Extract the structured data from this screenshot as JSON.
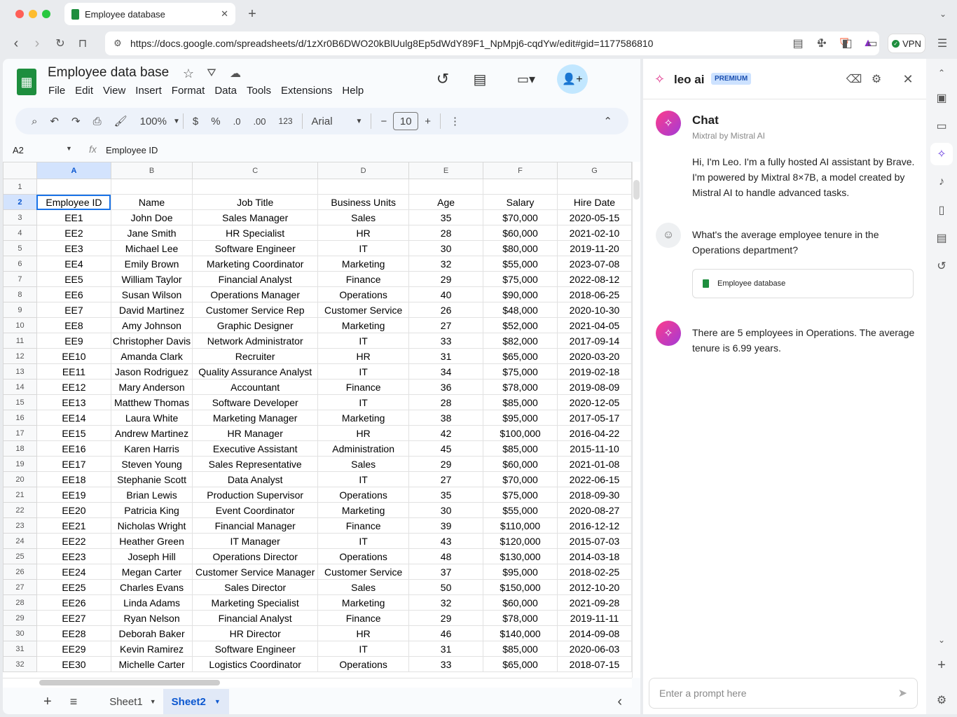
{
  "browser": {
    "tab_title": "Employee database",
    "url": "https://docs.google.com/spreadsheets/d/1zXr0B6DWO20kBlUulg8Ep5dWdY89F1_NpMpj6-cqdYw/edit#gid=1177586810",
    "vpn_label": "VPN",
    "brave_badge": "3"
  },
  "doc": {
    "title": "Employee data base",
    "menu": [
      "File",
      "Edit",
      "View",
      "Insert",
      "Format",
      "Data",
      "Tools",
      "Extensions",
      "Help"
    ]
  },
  "toolbar": {
    "zoom": "100%",
    "currency": "$",
    "percent": "%",
    "dec_less": ".0",
    "dec_more": ".00",
    "number_format": "123",
    "font": "Arial",
    "font_size": "10"
  },
  "formula_bar": {
    "cell_ref": "A2",
    "fx": "fx",
    "value": "Employee ID"
  },
  "sheet": {
    "columns": [
      "A",
      "B",
      "C",
      "D",
      "E",
      "F",
      "G"
    ],
    "header": [
      "Employee ID",
      "Name",
      "Job Title",
      "Business Units",
      "Age",
      "Salary",
      "Hire Date"
    ],
    "rows": [
      [
        "EE1",
        "John Doe",
        "Sales Manager",
        "Sales",
        "35",
        "$70,000",
        "2020-05-15"
      ],
      [
        "EE2",
        "Jane Smith",
        "HR Specialist",
        "HR",
        "28",
        "$60,000",
        "2021-02-10"
      ],
      [
        "EE3",
        "Michael Lee",
        "Software Engineer",
        "IT",
        "30",
        "$80,000",
        "2019-11-20"
      ],
      [
        "EE4",
        "Emily Brown",
        "Marketing Coordinator",
        "Marketing",
        "32",
        "$55,000",
        "2023-07-08"
      ],
      [
        "EE5",
        "William Taylor",
        "Financial Analyst",
        "Finance",
        "29",
        "$75,000",
        "2022-08-12"
      ],
      [
        "EE6",
        "Susan Wilson",
        "Operations Manager",
        "Operations",
        "40",
        "$90,000",
        "2018-06-25"
      ],
      [
        "EE7",
        "David Martinez",
        "Customer Service Rep",
        "Customer Service",
        "26",
        "$48,000",
        "2020-10-30"
      ],
      [
        "EE8",
        "Amy Johnson",
        "Graphic Designer",
        "Marketing",
        "27",
        "$52,000",
        "2021-04-05"
      ],
      [
        "EE9",
        "Christopher Davis",
        "Network Administrator",
        "IT",
        "33",
        "$82,000",
        "2017-09-14"
      ],
      [
        "EE10",
        "Amanda Clark",
        "Recruiter",
        "HR",
        "31",
        "$65,000",
        "2020-03-20"
      ],
      [
        "EE11",
        "Jason Rodriguez",
        "Quality Assurance Analyst",
        "IT",
        "34",
        "$75,000",
        "2019-02-18"
      ],
      [
        "EE12",
        "Mary Anderson",
        "Accountant",
        "Finance",
        "36",
        "$78,000",
        "2019-08-09"
      ],
      [
        "EE13",
        "Matthew Thomas",
        "Software Developer",
        "IT",
        "28",
        "$85,000",
        "2020-12-05"
      ],
      [
        "EE14",
        "Laura White",
        "Marketing Manager",
        "Marketing",
        "38",
        "$95,000",
        "2017-05-17"
      ],
      [
        "EE15",
        "Andrew Martinez",
        "HR Manager",
        "HR",
        "42",
        "$100,000",
        "2016-04-22"
      ],
      [
        "EE16",
        "Karen Harris",
        "Executive Assistant",
        "Administration",
        "45",
        "$85,000",
        "2015-11-10"
      ],
      [
        "EE17",
        "Steven Young",
        "Sales Representative",
        "Sales",
        "29",
        "$60,000",
        "2021-01-08"
      ],
      [
        "EE18",
        "Stephanie Scott",
        "Data Analyst",
        "IT",
        "27",
        "$70,000",
        "2022-06-15"
      ],
      [
        "EE19",
        "Brian Lewis",
        "Production Supervisor",
        "Operations",
        "35",
        "$75,000",
        "2018-09-30"
      ],
      [
        "EE20",
        "Patricia King",
        "Event Coordinator",
        "Marketing",
        "30",
        "$55,000",
        "2020-08-27"
      ],
      [
        "EE21",
        "Nicholas Wright",
        "Financial Manager",
        "Finance",
        "39",
        "$110,000",
        "2016-12-12"
      ],
      [
        "EE22",
        "Heather Green",
        "IT Manager",
        "IT",
        "43",
        "$120,000",
        "2015-07-03"
      ],
      [
        "EE23",
        "Joseph Hill",
        "Operations Director",
        "Operations",
        "48",
        "$130,000",
        "2014-03-18"
      ],
      [
        "EE24",
        "Megan Carter",
        "Customer Service Manager",
        "Customer Service",
        "37",
        "$95,000",
        "2018-02-25"
      ],
      [
        "EE25",
        "Charles Evans",
        "Sales Director",
        "Sales",
        "50",
        "$150,000",
        "2012-10-20"
      ],
      [
        "EE26",
        "Linda Adams",
        "Marketing Specialist",
        "Marketing",
        "32",
        "$60,000",
        "2021-09-28"
      ],
      [
        "EE27",
        "Ryan Nelson",
        "Financial Analyst",
        "Finance",
        "29",
        "$78,000",
        "2019-11-11"
      ],
      [
        "EE28",
        "Deborah Baker",
        "HR Director",
        "HR",
        "46",
        "$140,000",
        "2014-09-08"
      ],
      [
        "EE29",
        "Kevin Ramirez",
        "Software Engineer",
        "IT",
        "31",
        "$85,000",
        "2020-06-03"
      ],
      [
        "EE30",
        "Michelle Carter",
        "Logistics Coordinator",
        "Operations",
        "33",
        "$65,000",
        "2018-07-15"
      ]
    ],
    "tabs": [
      "Sheet1",
      "Sheet2"
    ],
    "active_tab": "Sheet2"
  },
  "leo": {
    "name": "leo ai",
    "badge": "PREMIUM",
    "chat_title": "Chat",
    "model": "Mixtral by Mistral AI",
    "intro": "Hi, I'm Leo. I'm a fully hosted AI assistant by Brave. I'm powered by Mixtral 8×7B, a model created by Mistral AI to handle advanced tasks.",
    "question": "What's the average employee tenure in the Operations department?",
    "attachment": "Employee database",
    "answer": "There are 5 employees in Operations. The average tenure is 6.99 years.",
    "placeholder": "Enter a prompt here"
  }
}
